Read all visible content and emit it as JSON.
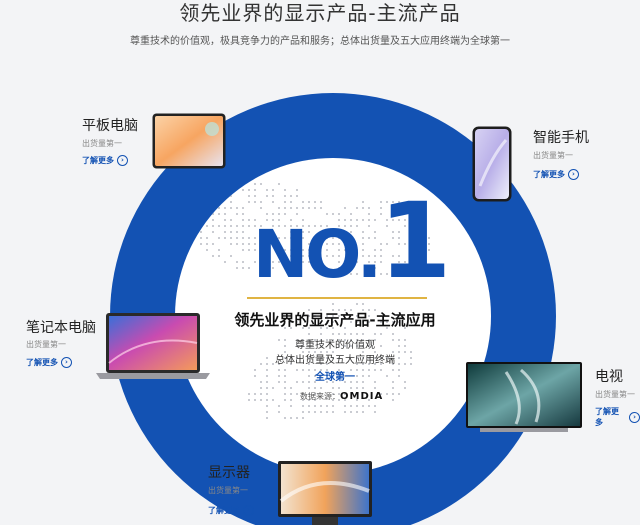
{
  "header": {
    "title": "领先业界的显示产品-主流产品",
    "subtitle": "尊重技术的价值观，极具竞争力的产品和服务；总体出货量及五大应用终端为全球第一"
  },
  "center": {
    "rank": "NO.1",
    "rank_no": "NO.",
    "rank_num": "1",
    "title": "领先业界的显示产品-主流应用",
    "line1": "尊重技术的价值观",
    "line2": "总体出货量及五大应用终端",
    "link": "全球第一",
    "source_label": "数据来源：",
    "source_name": "OMDIA"
  },
  "products": {
    "tablet": {
      "title": "平板电脑",
      "sub": "出货量第一",
      "link": "了解更多"
    },
    "phone": {
      "title": "智能手机",
      "sub": "出货量第一",
      "link": "了解更多"
    },
    "laptop": {
      "title": "笔记本电脑",
      "sub": "出货量第一",
      "link": "了解更多"
    },
    "tv": {
      "title": "电视",
      "sub": "出货量第一",
      "link": "了解更多"
    },
    "monitor": {
      "title": "显示器",
      "sub": "出货量第一",
      "link": "了解更多"
    }
  },
  "colors": {
    "ring": "#1352b3",
    "accent": "#e0b443",
    "link": "#1352b3"
  },
  "icons": {
    "link_arrow": "chevron-right-circle-icon"
  }
}
